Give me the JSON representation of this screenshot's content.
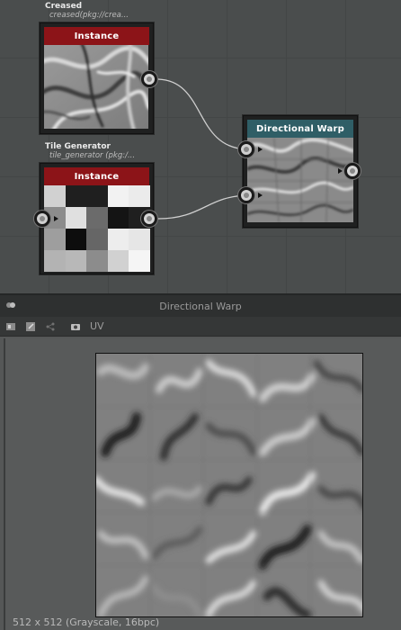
{
  "graph": {
    "nodes": [
      {
        "id": "creased",
        "title": "Creased",
        "subtitle": "creased(pkg://crea...",
        "header": "Instance"
      },
      {
        "id": "tile",
        "title": "Tile Generator",
        "subtitle": "tile_generator (pkg:/...",
        "header": "Instance"
      },
      {
        "id": "warp",
        "header": "Directional Warp"
      }
    ],
    "tile_pattern": [
      [
        0.82,
        0.12,
        0.12,
        0.95,
        0.92
      ],
      [
        0.55,
        0.88,
        0.42,
        0.08,
        0.12
      ],
      [
        0.62,
        0.05,
        0.4,
        0.93,
        0.9
      ],
      [
        0.7,
        0.72,
        0.55,
        0.82,
        0.96
      ]
    ]
  },
  "viewer": {
    "title": "Directional Warp",
    "toolbar": {
      "uv_label": "UV"
    },
    "status": "512 x 512 (Grayscale, 16bpc)"
  },
  "colors": {
    "instance_header": "#8c1418",
    "warp_header": "#2f5e66"
  }
}
